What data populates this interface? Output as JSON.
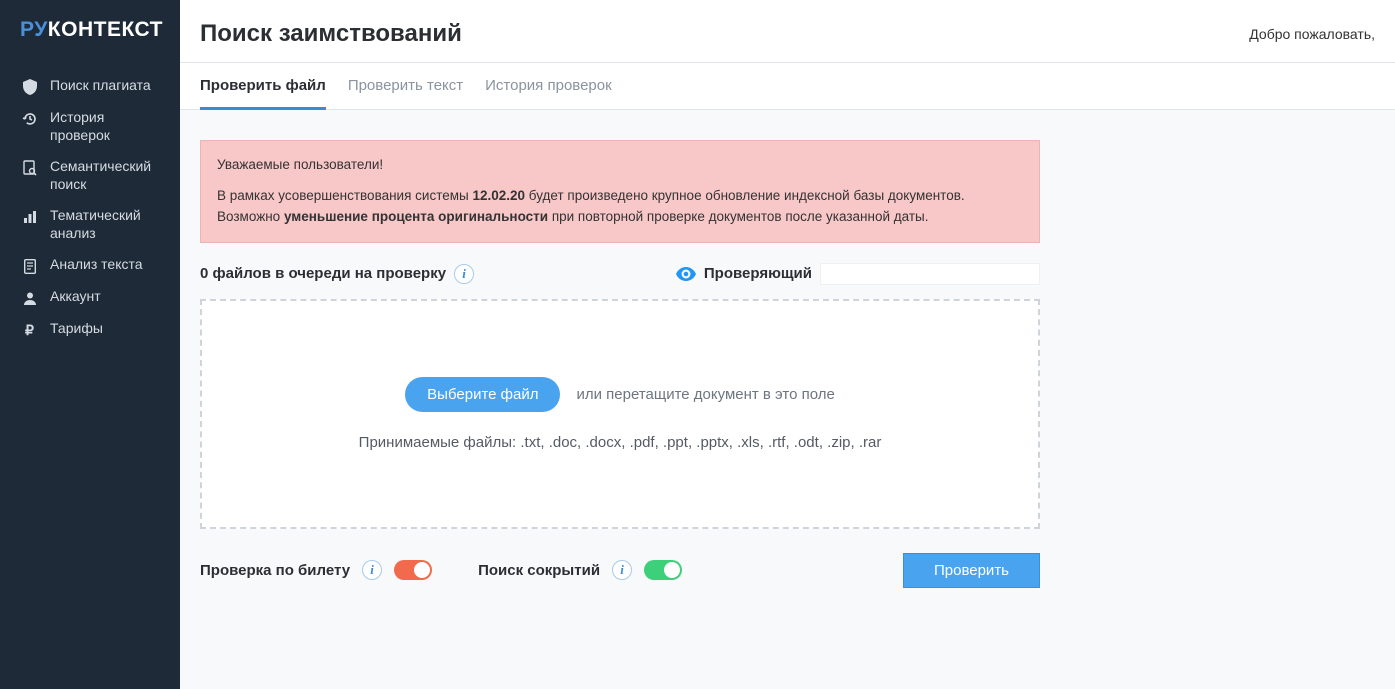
{
  "logo": {
    "ru": "РУ",
    "kontekst": "КОНТЕКСТ"
  },
  "sidebar": {
    "items": [
      {
        "label": "Поиск плагиата"
      },
      {
        "label": "История проверок"
      },
      {
        "label": "Семантический поиск"
      },
      {
        "label": "Тематический анализ"
      },
      {
        "label": "Анализ текста"
      },
      {
        "label": "Аккаунт"
      },
      {
        "label": "Тарифы"
      }
    ]
  },
  "header": {
    "title": "Поиск заимствований",
    "welcome": "Добро пожаловать,"
  },
  "tabs": [
    {
      "label": "Проверить файл"
    },
    {
      "label": "Проверить текст"
    },
    {
      "label": "История проверок"
    }
  ],
  "alert": {
    "greeting": "Уважаемые пользователи!",
    "line1_pre": "В рамках усовершенствования системы ",
    "line1_date": "12.02.20",
    "line1_post": " будет произведено крупное обновление индексной базы документов.",
    "line2_pre": "Возможно ",
    "line2_bold": "уменьшение процента оригинальности",
    "line2_post": " при повторной проверке документов после указанной даты."
  },
  "queue": {
    "count_text": "0 файлов в очереди на проверку",
    "reviewer_label": "Проверяющий"
  },
  "dropzone": {
    "button": "Выберите файл",
    "hint": "или перетащите документ в это поле",
    "formats": "Принимаемые файлы: .txt, .doc, .docx, .pdf, .ppt, .pptx, .xls, .rtf, .odt, .zip, .rar"
  },
  "controls": {
    "ticket_label": "Проверка по билету",
    "hidden_label": "Поиск сокрытий",
    "check_button": "Проверить"
  }
}
